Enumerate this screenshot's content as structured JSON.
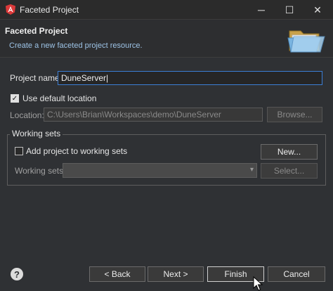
{
  "window": {
    "title": "Faceted Project",
    "controls": {
      "minimize": "─",
      "maximize": "☐",
      "close": "✕"
    }
  },
  "header": {
    "title": "Faceted Project",
    "description": "Create a new faceted project resource."
  },
  "form": {
    "project_name_label": "Project name:",
    "project_name_value": "DuneServer",
    "use_default_location_label": "Use default location",
    "use_default_location_checked": true,
    "location_label": "Location:",
    "location_value": "C:\\Users\\Brian\\Workspaces\\demo\\DuneServer",
    "browse_label": "Browse..."
  },
  "working_sets": {
    "group_title": "Working sets",
    "add_label": "Add project to working sets",
    "add_checked": false,
    "new_label": "New...",
    "working_sets_label": "Working sets:",
    "combo_value": "",
    "select_label": "Select..."
  },
  "footer": {
    "help": "?",
    "back_label": "< Back",
    "next_label": "Next >",
    "finish_label": "Finish",
    "cancel_label": "Cancel"
  },
  "colors": {
    "background": "#2f3134",
    "accent": "#3b7ed6",
    "app_icon": "#dd3a3a"
  }
}
